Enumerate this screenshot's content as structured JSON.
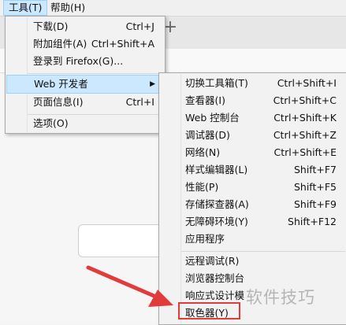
{
  "menubar": {
    "tools": "工具(T)",
    "help": "帮助(H)"
  },
  "tools_menu": {
    "items": [
      {
        "label": "下载(D)",
        "shortcut": "Ctrl+J"
      },
      {
        "label": "附加组件(A)",
        "shortcut": "Ctrl+Shift+A"
      },
      {
        "label": "登录到 Firefox(G)...",
        "shortcut": ""
      },
      {
        "label": "Web 开发者",
        "shortcut": ""
      },
      {
        "label": "页面信息(I)",
        "shortcut": "Ctrl+I"
      },
      {
        "label": "选项(O)",
        "shortcut": ""
      }
    ]
  },
  "web_dev_menu": {
    "items": [
      {
        "label": "切换工具箱(T)",
        "shortcut": "Ctrl+Shift+I"
      },
      {
        "label": "查看器(I)",
        "shortcut": "Ctrl+Shift+C"
      },
      {
        "label": "Web 控制台",
        "shortcut": "Ctrl+Shift+K"
      },
      {
        "label": "调试器(D)",
        "shortcut": "Ctrl+Shift+Z"
      },
      {
        "label": "网络(N)",
        "shortcut": "Ctrl+Shift+E"
      },
      {
        "label": "样式编辑器(L)",
        "shortcut": "Shift+F7"
      },
      {
        "label": "性能(P)",
        "shortcut": "Shift+F5"
      },
      {
        "label": "存储探查器(A)",
        "shortcut": "Shift+F9"
      },
      {
        "label": "无障碍环境(Y)",
        "shortcut": "Shift+F12"
      },
      {
        "label": "应用程序",
        "shortcut": ""
      },
      {
        "label": "远程调试(R)",
        "shortcut": ""
      },
      {
        "label": "浏览器控制台",
        "shortcut": ""
      },
      {
        "label": "响应式设计模",
        "shortcut": ""
      },
      {
        "label": "取色器(Y)",
        "shortcut": ""
      }
    ]
  },
  "new_tab_icon": "+",
  "watermark": "软件技巧",
  "colors": {
    "highlight": "#cce8ff",
    "annotation": "#e23b3b"
  }
}
